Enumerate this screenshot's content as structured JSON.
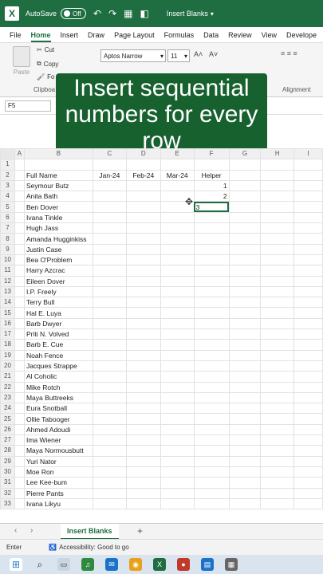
{
  "titlebar": {
    "autosave_label": "AutoSave",
    "autosave_state": "Off",
    "title": "Insert Blanks",
    "app_icon": "excel-icon",
    "accent": "#1e6e42"
  },
  "ribbon_tabs": [
    "File",
    "Home",
    "Insert",
    "Draw",
    "Page Layout",
    "Formulas",
    "Data",
    "Review",
    "View",
    "Develope"
  ],
  "ribbon": {
    "paste": "Paste",
    "cut": "Cut",
    "copy": "Copy",
    "format": "Fo",
    "clipboard_group": "Clipboa",
    "font_name": "Aptos Narrow",
    "font_size": "11",
    "alignment_group": "Alignment"
  },
  "caption": {
    "text": "Insert sequential numbers for every row",
    "background": "#17612f"
  },
  "formula_bar": {
    "name_box": "F5"
  },
  "grid": {
    "columns": [
      "A",
      "B",
      "C",
      "D",
      "E",
      "F",
      "G",
      "H",
      "I"
    ],
    "header_row": [
      "Full Name",
      "Jan-24",
      "Feb-24",
      "Mar-24",
      "Helper"
    ],
    "names": [
      "Seymour Butz",
      "Anita Bath",
      "Ben Dover",
      "Ivana Tinkle",
      "Hugh Jass",
      "Amanda Hugginkiss",
      "Justin Case",
      "Bea O'Problem",
      "Harry Azcrac",
      "Eileen Dover",
      "I.P. Freely",
      "Terry Bull",
      "Hal E. Luya",
      "Barb Dwyer",
      "Priti N. Volved",
      "Barb E. Cue",
      "Noah Fence",
      "Jacques Strappe",
      "Al Coholic",
      "Mike Rotch",
      "Maya Buttreeks",
      "Eura Snotball",
      "Ollie Tabooger",
      "Ahmed Adoudi",
      "Ima Wiener",
      "Maya Normousbutt",
      "Yuri Nator",
      "Moe Ron",
      "Lee Kee-bum",
      "Pierre Pants",
      "Ivana Likyu"
    ],
    "helper_values": [
      "1",
      "2"
    ],
    "active_cell_value": "3"
  },
  "sheet_tabs": {
    "active": "Insert Blanks",
    "add": "+"
  },
  "statusbar": {
    "mode": "Enter",
    "accessibility": "Accessibility: Good to go"
  }
}
